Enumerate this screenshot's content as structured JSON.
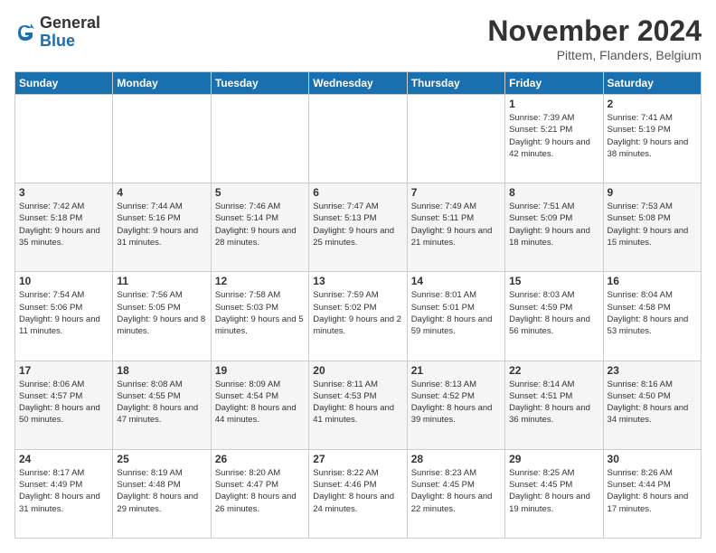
{
  "logo": {
    "general": "General",
    "blue": "Blue"
  },
  "title": {
    "month_year": "November 2024",
    "location": "Pittem, Flanders, Belgium"
  },
  "headers": [
    "Sunday",
    "Monday",
    "Tuesday",
    "Wednesday",
    "Thursday",
    "Friday",
    "Saturday"
  ],
  "weeks": [
    [
      {
        "day": "",
        "info": ""
      },
      {
        "day": "",
        "info": ""
      },
      {
        "day": "",
        "info": ""
      },
      {
        "day": "",
        "info": ""
      },
      {
        "day": "",
        "info": ""
      },
      {
        "day": "1",
        "info": "Sunrise: 7:39 AM\nSunset: 5:21 PM\nDaylight: 9 hours and 42 minutes."
      },
      {
        "day": "2",
        "info": "Sunrise: 7:41 AM\nSunset: 5:19 PM\nDaylight: 9 hours and 38 minutes."
      }
    ],
    [
      {
        "day": "3",
        "info": "Sunrise: 7:42 AM\nSunset: 5:18 PM\nDaylight: 9 hours and 35 minutes."
      },
      {
        "day": "4",
        "info": "Sunrise: 7:44 AM\nSunset: 5:16 PM\nDaylight: 9 hours and 31 minutes."
      },
      {
        "day": "5",
        "info": "Sunrise: 7:46 AM\nSunset: 5:14 PM\nDaylight: 9 hours and 28 minutes."
      },
      {
        "day": "6",
        "info": "Sunrise: 7:47 AM\nSunset: 5:13 PM\nDaylight: 9 hours and 25 minutes."
      },
      {
        "day": "7",
        "info": "Sunrise: 7:49 AM\nSunset: 5:11 PM\nDaylight: 9 hours and 21 minutes."
      },
      {
        "day": "8",
        "info": "Sunrise: 7:51 AM\nSunset: 5:09 PM\nDaylight: 9 hours and 18 minutes."
      },
      {
        "day": "9",
        "info": "Sunrise: 7:53 AM\nSunset: 5:08 PM\nDaylight: 9 hours and 15 minutes."
      }
    ],
    [
      {
        "day": "10",
        "info": "Sunrise: 7:54 AM\nSunset: 5:06 PM\nDaylight: 9 hours and 11 minutes."
      },
      {
        "day": "11",
        "info": "Sunrise: 7:56 AM\nSunset: 5:05 PM\nDaylight: 9 hours and 8 minutes."
      },
      {
        "day": "12",
        "info": "Sunrise: 7:58 AM\nSunset: 5:03 PM\nDaylight: 9 hours and 5 minutes."
      },
      {
        "day": "13",
        "info": "Sunrise: 7:59 AM\nSunset: 5:02 PM\nDaylight: 9 hours and 2 minutes."
      },
      {
        "day": "14",
        "info": "Sunrise: 8:01 AM\nSunset: 5:01 PM\nDaylight: 8 hours and 59 minutes."
      },
      {
        "day": "15",
        "info": "Sunrise: 8:03 AM\nSunset: 4:59 PM\nDaylight: 8 hours and 56 minutes."
      },
      {
        "day": "16",
        "info": "Sunrise: 8:04 AM\nSunset: 4:58 PM\nDaylight: 8 hours and 53 minutes."
      }
    ],
    [
      {
        "day": "17",
        "info": "Sunrise: 8:06 AM\nSunset: 4:57 PM\nDaylight: 8 hours and 50 minutes."
      },
      {
        "day": "18",
        "info": "Sunrise: 8:08 AM\nSunset: 4:55 PM\nDaylight: 8 hours and 47 minutes."
      },
      {
        "day": "19",
        "info": "Sunrise: 8:09 AM\nSunset: 4:54 PM\nDaylight: 8 hours and 44 minutes."
      },
      {
        "day": "20",
        "info": "Sunrise: 8:11 AM\nSunset: 4:53 PM\nDaylight: 8 hours and 41 minutes."
      },
      {
        "day": "21",
        "info": "Sunrise: 8:13 AM\nSunset: 4:52 PM\nDaylight: 8 hours and 39 minutes."
      },
      {
        "day": "22",
        "info": "Sunrise: 8:14 AM\nSunset: 4:51 PM\nDaylight: 8 hours and 36 minutes."
      },
      {
        "day": "23",
        "info": "Sunrise: 8:16 AM\nSunset: 4:50 PM\nDaylight: 8 hours and 34 minutes."
      }
    ],
    [
      {
        "day": "24",
        "info": "Sunrise: 8:17 AM\nSunset: 4:49 PM\nDaylight: 8 hours and 31 minutes."
      },
      {
        "day": "25",
        "info": "Sunrise: 8:19 AM\nSunset: 4:48 PM\nDaylight: 8 hours and 29 minutes."
      },
      {
        "day": "26",
        "info": "Sunrise: 8:20 AM\nSunset: 4:47 PM\nDaylight: 8 hours and 26 minutes."
      },
      {
        "day": "27",
        "info": "Sunrise: 8:22 AM\nSunset: 4:46 PM\nDaylight: 8 hours and 24 minutes."
      },
      {
        "day": "28",
        "info": "Sunrise: 8:23 AM\nSunset: 4:45 PM\nDaylight: 8 hours and 22 minutes."
      },
      {
        "day": "29",
        "info": "Sunrise: 8:25 AM\nSunset: 4:45 PM\nDaylight: 8 hours and 19 minutes."
      },
      {
        "day": "30",
        "info": "Sunrise: 8:26 AM\nSunset: 4:44 PM\nDaylight: 8 hours and 17 minutes."
      }
    ]
  ]
}
